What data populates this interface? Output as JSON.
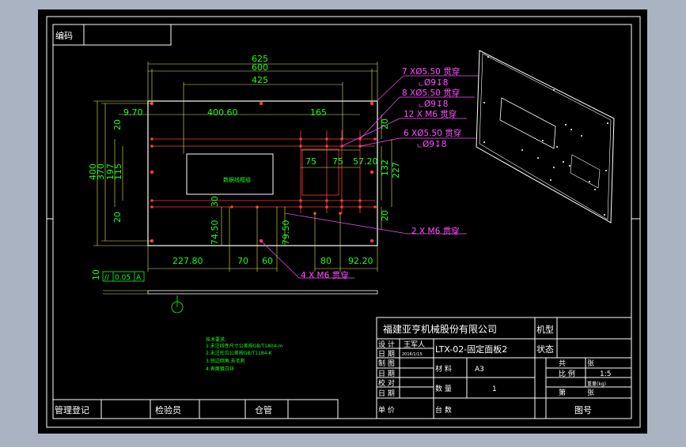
{
  "drawing": {
    "code_label": "编码",
    "main_dims": {
      "w625": "625",
      "w600": "600",
      "w425": "425",
      "d970": "9.70",
      "d40060": "400.60",
      "d165": "165",
      "h400": "400",
      "h370": "370",
      "h197": "197",
      "h115": "115",
      "d20a": "20",
      "d20b": "20",
      "d20c": "20",
      "d20d": "20",
      "d75a": "75",
      "d75b": "75",
      "d5720": "57.20",
      "d132": "132",
      "d227": "227",
      "d30": "30",
      "d7450": "74.50",
      "d7950": "79.50",
      "d22780": "227.80",
      "d70": "70",
      "d60": "60",
      "d80": "80",
      "d9220": "92.20",
      "d10": "10"
    },
    "panel_text": "数据线框组",
    "tolerance": {
      "sym": "//",
      "value": "0.05",
      "datum": "A"
    },
    "callouts": {
      "c1_l1": "7 XØ5.50 贯穿",
      "c1_l2": "Ø9↧8",
      "c2_l1": "8 XØ5.50 贯穿",
      "c2_l2": "Ø9↧8",
      "c3_l1": "12 X M6 贯穿",
      "c4_l1": "6 XØ5.50 贯穿",
      "c4_l2": "Ø9↧8",
      "c5_l1": "2 X M6 贯穿",
      "c6_l1": "4 X M6 贯穿"
    },
    "notes": {
      "title": "技术要求:",
      "line1": "1.未注线性尺寸公差按GB/T1804-m",
      "line2": "2.未注形位公差按GB/T1184-K",
      "line3": "3.锐边倒角,去毛刺",
      "line4": "4.表面镀白锌"
    },
    "bottom_row": {
      "reg": "管理登记",
      "inspector": "检验员",
      "storage": "仓管"
    },
    "title_block": {
      "company": "福建亚亨机械股份有限公司",
      "model_label": "机型",
      "design_label": "设 计",
      "designer": "王军人",
      "date_label1": "日 期",
      "date1": "2016/1/15",
      "drawing_name": "LTX-02-固定面板2",
      "status_label": "状态",
      "draw_label": "制 图",
      "date_label2": "日 期",
      "material_label": "材 料",
      "material": "A3",
      "check_label": "校 对",
      "date_label3": "日 期",
      "audit_label": "审 核",
      "date_label4": "日 期",
      "qty_label": "数 量",
      "qty": "1",
      "batch_label": "单 价",
      "sets_label": "台 数",
      "scale_label": "比 例",
      "scale": "1:5",
      "weight_label": "重量(kg)",
      "sheet_label": "图号",
      "side_chars": "图\n号",
      "right_small1": "共",
      "right_small2": "张",
      "right_small3": "第",
      "right_small4": "张"
    }
  }
}
